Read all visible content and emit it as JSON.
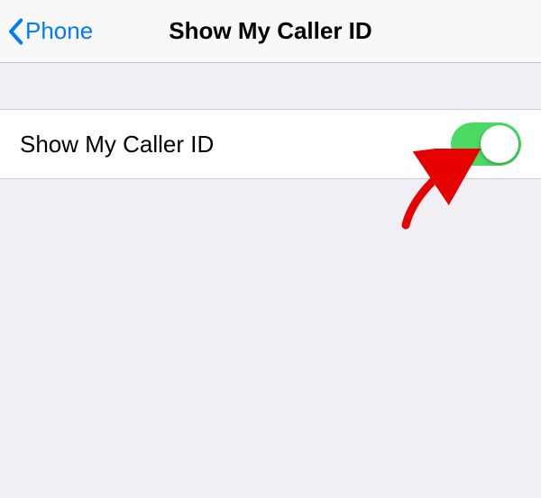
{
  "header": {
    "back_label": "Phone",
    "title": "Show My Caller ID"
  },
  "settings": {
    "caller_id_row": {
      "label": "Show My Caller ID",
      "enabled": true
    }
  },
  "colors": {
    "tint": "#007aff",
    "toggle_on": "#4cd964",
    "annotation": "#e60000"
  }
}
